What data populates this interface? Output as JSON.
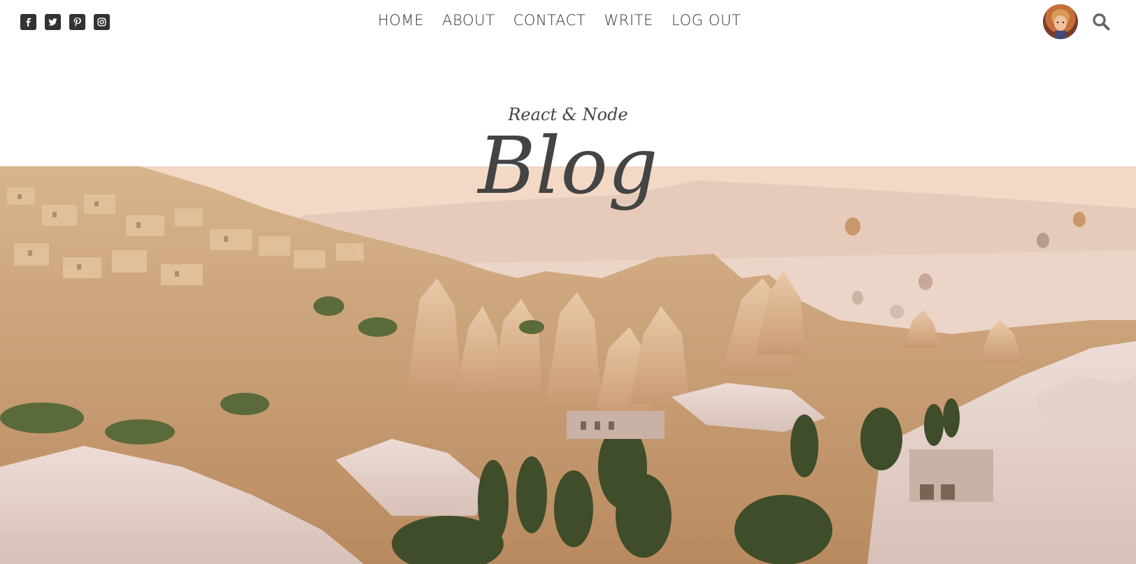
{
  "social": [
    {
      "name": "facebook-icon"
    },
    {
      "name": "twitter-icon"
    },
    {
      "name": "pinterest-icon"
    },
    {
      "name": "instagram-icon"
    }
  ],
  "nav": {
    "home": "HOME",
    "about": "ABOUT",
    "contact": "CONTACT",
    "write": "WRITE",
    "logout": "LOG OUT"
  },
  "header": {
    "subtitle": "React & Node",
    "title": "Blog"
  },
  "icons": {
    "search": "search-icon",
    "avatar": "user-avatar"
  },
  "colors": {
    "text": "#444444",
    "icon": "#333333",
    "sky": "#f3dccb"
  }
}
